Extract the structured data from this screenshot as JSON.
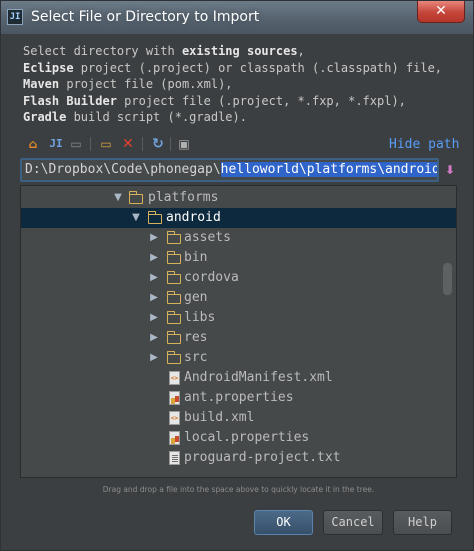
{
  "window": {
    "title": "Select File or Directory to Import",
    "app_icon": "JI",
    "close_glyph": "✕"
  },
  "description": {
    "line1": "Select directory with ",
    "line1_bold": "existing sources",
    "line1_end": ",",
    "line2_bold": "Eclipse",
    "line2": " project (.project) or classpath (.classpath) file,",
    "line3_bold": "Maven",
    "line3": " project file (pom.xml),",
    "line4_bold": "Flash Builder",
    "line4": " project file (.project, *.fxp, *.fxpl),",
    "line5_bold": "Gradle",
    "line5": " build script (*.gradle)."
  },
  "toolbar": {
    "home_icon": "⌂",
    "project_icon": "JI",
    "folder_icon": "▭",
    "new_folder_icon": "▭",
    "delete_icon": "✕",
    "refresh_icon": "↻",
    "show_hidden_icon": "▣",
    "hide_path_label": "Hide path"
  },
  "path": {
    "prefix": "D:\\Dropbox\\Code\\phonegap\\",
    "selected": "helloworld\\platforms\\android"
  },
  "tree": {
    "items": [
      {
        "label": "platforms",
        "type": "folder",
        "arrow": "▼"
      },
      {
        "label": "android",
        "type": "folder",
        "arrow": "▼"
      },
      {
        "label": "assets",
        "type": "folder",
        "arrow": "▶"
      },
      {
        "label": "bin",
        "type": "folder",
        "arrow": "▶"
      },
      {
        "label": "cordova",
        "type": "folder",
        "arrow": "▶"
      },
      {
        "label": "gen",
        "type": "folder",
        "arrow": "▶"
      },
      {
        "label": "libs",
        "type": "folder",
        "arrow": "▶"
      },
      {
        "label": "res",
        "type": "folder",
        "arrow": "▶"
      },
      {
        "label": "src",
        "type": "folder",
        "arrow": "▶"
      },
      {
        "label": "AndroidManifest.xml",
        "type": "xml"
      },
      {
        "label": "ant.properties",
        "type": "properties"
      },
      {
        "label": "build.xml",
        "type": "xml"
      },
      {
        "label": "local.properties",
        "type": "properties"
      },
      {
        "label": "proguard-project.txt",
        "type": "txt"
      }
    ]
  },
  "hint": "Drag and drop a file into the space above to quickly locate it in the tree.",
  "buttons": {
    "ok": "OK",
    "cancel": "Cancel",
    "help": "Help"
  },
  "colors": {
    "accent": "#589df6",
    "selection": "#2f65ca",
    "tree_selection": "#0d293e"
  }
}
